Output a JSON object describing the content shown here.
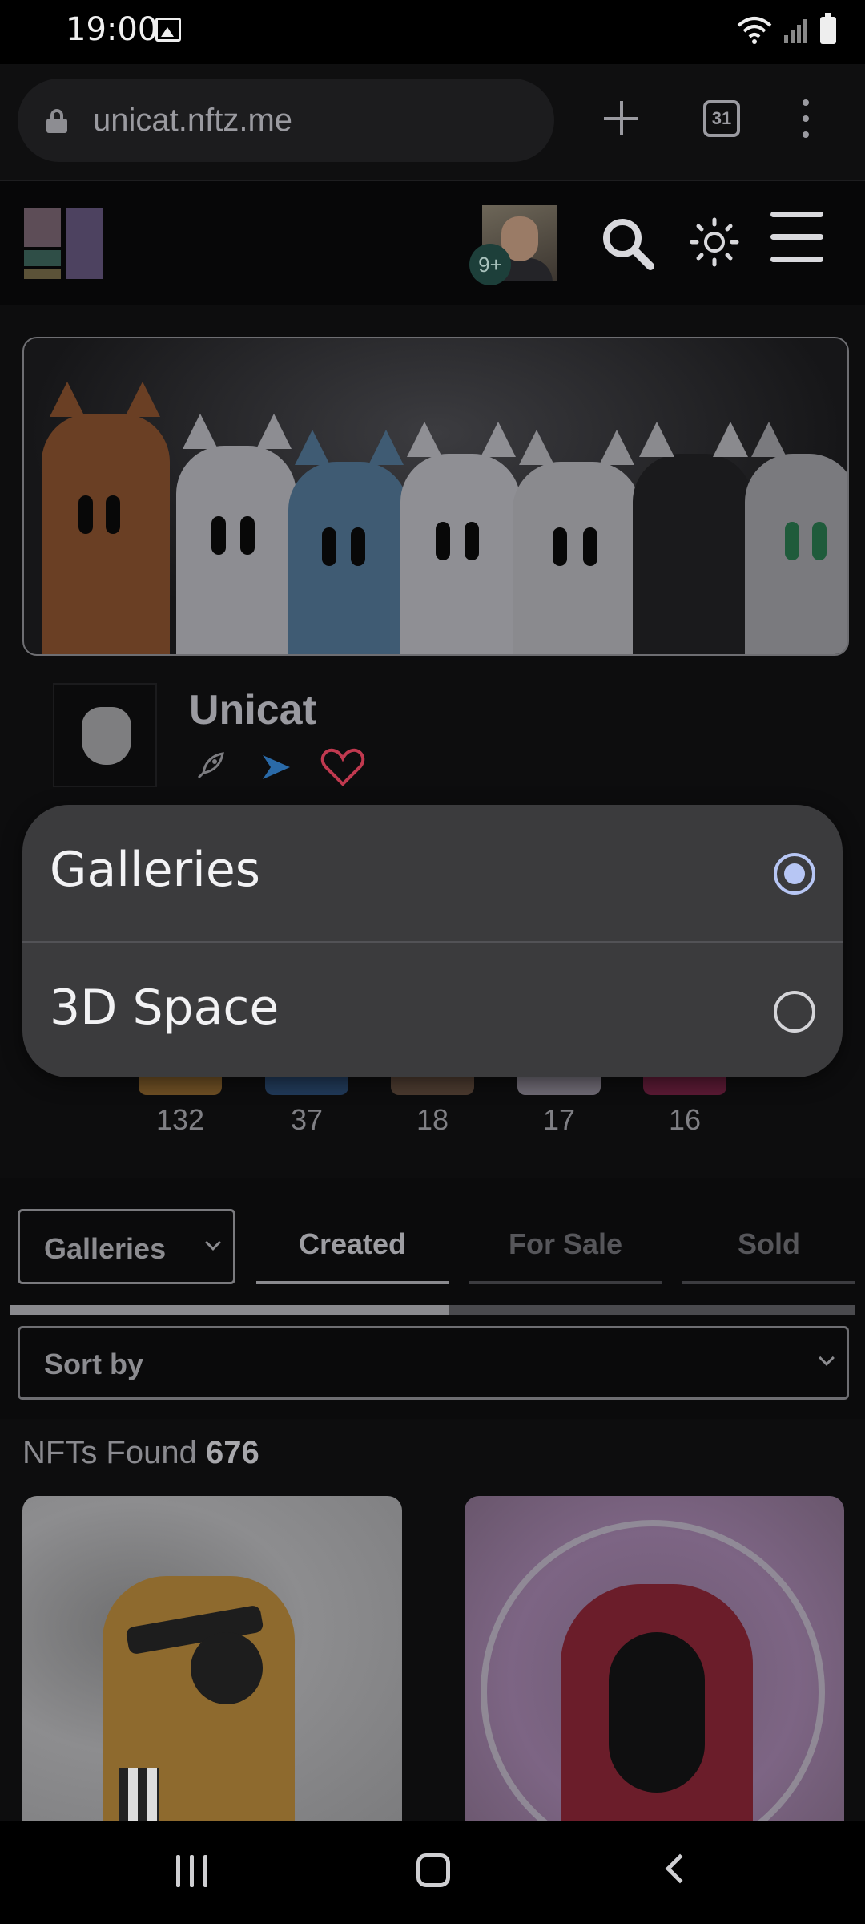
{
  "status_bar": {
    "time": "19:00"
  },
  "browser": {
    "url": "unicat.nftz.me",
    "tab_count": "31"
  },
  "header": {
    "notification_badge": "9+"
  },
  "collection": {
    "name": "Unicat"
  },
  "stats": [
    "132",
    "37",
    "18",
    "17",
    "16"
  ],
  "filters": {
    "view_select": "Galleries",
    "tabs": [
      "Created",
      "For Sale",
      "Sold"
    ],
    "active_tab": "Created",
    "sort_placeholder": "Sort by"
  },
  "results": {
    "label": "NFTs Found",
    "count": "676"
  },
  "dialog": {
    "options": [
      {
        "label": "Galleries",
        "selected": true
      },
      {
        "label": "3D Space",
        "selected": false
      }
    ]
  },
  "colors": {
    "accent_radio": "#b7c6f4",
    "heart": "#c0394f",
    "dialog_bg": "#3b3b3d"
  }
}
